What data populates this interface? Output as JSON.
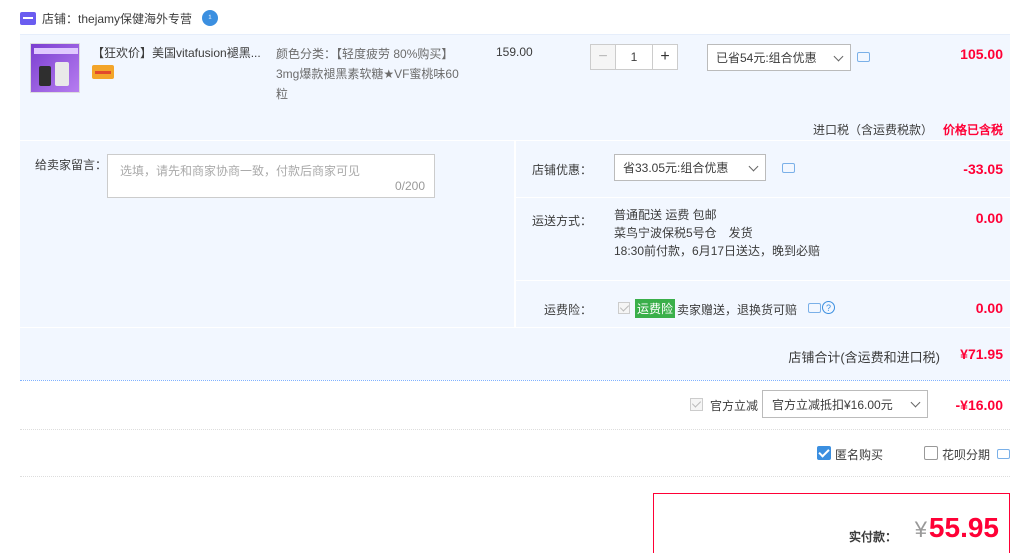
{
  "shop": {
    "label": "店铺：",
    "name": "thejamy保健海外专营"
  },
  "item": {
    "title": "【狂欢价】美国vitafusion褪黑...",
    "sku_label": "颜色分类：",
    "sku_value": "【轻度疲劳 80%购买】3mg爆款褪黑素软糖★VF蜜桃味60粒",
    "unit_price": "159.00",
    "quantity": "1",
    "promo_selected": "已省54元:组合优惠",
    "total": "105.00",
    "tax_label": "进口税（含运费税款）",
    "tax_status": "价格已含税"
  },
  "note": {
    "label": "给卖家留言：",
    "placeholder": "选填，请先和商家协商一致，付款后商家可见",
    "counter": "0/200"
  },
  "shop_discount": {
    "label": "店铺优惠：",
    "selected": "省33.05元:组合优惠",
    "amount": "-33.05"
  },
  "shipping": {
    "label": "运送方式：",
    "line1": "普通配送 运费 包邮",
    "line2": "菜鸟宁波保税5号仓　发货",
    "line3": "18:30前付款，6月17日送达，晚到必赔",
    "amount": "0.00"
  },
  "insurance": {
    "label": "运费险：",
    "tag": "运费险",
    "text": "卖家赠送，退换货可赔",
    "amount": "0.00"
  },
  "shop_total": {
    "label": "店铺合计(含运费和进口税)",
    "value": "¥71.95"
  },
  "official": {
    "label": "官方立减",
    "selected": "官方立减抵扣¥16.00元",
    "amount": "-¥16.00"
  },
  "options": {
    "anonymous": "匿名购买",
    "huabei": "花呗分期"
  },
  "payment": {
    "label": "实付款：",
    "currency": "¥",
    "value": "55.95"
  }
}
